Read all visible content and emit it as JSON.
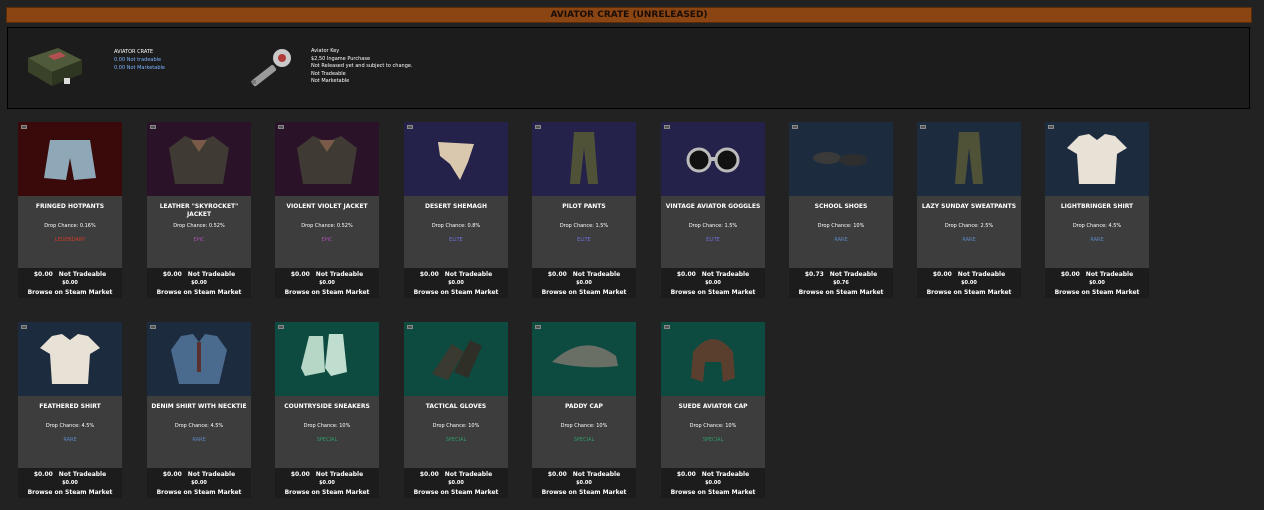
{
  "header": {
    "title": "AVIATOR CRATE (UNRELEASED)"
  },
  "crate": {
    "name": "AVIATOR CRATE",
    "tradeable": "0.00 Not tradeable",
    "marketable": "0.00 Not Marketable"
  },
  "key": {
    "name": "Aviator Key",
    "price": "$2,50 Ingame Purchase",
    "note": "Not Released yet and subject to change.",
    "tradeable": "Not Tradeable",
    "marketable": "Not Marketable"
  },
  "colors": {
    "title_bar": "#8b4513",
    "legendary": "#d03b2a",
    "epic": "#a64fb0",
    "elite": "#6f6fe0",
    "rare": "#5a86c0",
    "special": "#2f9a6a"
  },
  "items": [
    {
      "name": "FRINGED HOTPANTS",
      "chance": "Drop Chance: 0.16%",
      "rarity": "LEGENDARY",
      "price": "$0.00",
      "status": "Not Tradeable",
      "sub": "$0.00",
      "browse": "Browse on Steam Market",
      "bg": "#3a0a0a",
      "icon": "shorts-icon"
    },
    {
      "name": "LEATHER \"SKYROCKET\" JACKET",
      "chance": "Drop Chance: 0.52%",
      "rarity": "EPIC",
      "price": "$0.00",
      "status": "Not Tradeable",
      "sub": "$0.00",
      "browse": "Browse on Steam Market",
      "bg": "#2a1328",
      "icon": "jacket-icon"
    },
    {
      "name": "VIOLENT VIOLET JACKET",
      "chance": "Drop Chance: 0.52%",
      "rarity": "EPIC",
      "price": "$0.00",
      "status": "Not Tradeable",
      "sub": "$0.00",
      "browse": "Browse on Steam Market",
      "bg": "#2a1328",
      "icon": "jacket-icon"
    },
    {
      "name": "DESERT SHEMAGH",
      "chance": "Drop Chance: 0.8%",
      "rarity": "ELITE",
      "price": "$0.00",
      "status": "Not Tradeable",
      "sub": "$0.00",
      "browse": "Browse on Steam Market",
      "bg": "#24214a",
      "icon": "scarf-icon"
    },
    {
      "name": "PILOT PANTS",
      "chance": "Drop Chance: 1.5%",
      "rarity": "ELITE",
      "price": "$0.00",
      "status": "Not Tradeable",
      "sub": "$0.00",
      "browse": "Browse on Steam Market",
      "bg": "#24214a",
      "icon": "pants-icon"
    },
    {
      "name": "VINTAGE AVIATOR GOGGLES",
      "chance": "Drop Chance: 1.5%",
      "rarity": "ELITE",
      "price": "$0.00",
      "status": "Not Tradeable",
      "sub": "$0.00",
      "browse": "Browse on Steam Market",
      "bg": "#24214a",
      "icon": "goggles-icon"
    },
    {
      "name": "SCHOOL SHOES",
      "chance": "Drop Chance: 10%",
      "rarity": "RARE",
      "price": "$0.73",
      "status": "Not Tradeable",
      "sub": "$0.76",
      "browse": "Browse on Steam Market",
      "bg": "#1d2b3e",
      "icon": "shoes-icon"
    },
    {
      "name": "LAZY SUNDAY SWEATPANTS",
      "chance": "Drop Chance: 2.5%",
      "rarity": "RARE",
      "price": "$0.00",
      "status": "Not Tradeable",
      "sub": "$0.00",
      "browse": "Browse on Steam Market",
      "bg": "#1d2b3e",
      "icon": "pants-icon"
    },
    {
      "name": "LIGHTBRINGER SHIRT",
      "chance": "Drop Chance: 4.5%",
      "rarity": "RARE",
      "price": "$0.00",
      "status": "Not Tradeable",
      "sub": "$0.00",
      "browse": "Browse on Steam Market",
      "bg": "#1d2b3e",
      "icon": "tshirt-icon"
    },
    {
      "name": "FEATHERED SHIRT",
      "chance": "Drop Chance: 4.5%",
      "rarity": "RARE",
      "price": "$0.00",
      "status": "Not Tradeable",
      "sub": "$0.00",
      "browse": "Browse on Steam Market",
      "bg": "#1d2b3e",
      "icon": "tshirt-icon"
    },
    {
      "name": "DENIM SHIRT WITH NECKTIE",
      "chance": "Drop Chance: 4.5%",
      "rarity": "RARE",
      "price": "$0.00",
      "status": "Not Tradeable",
      "sub": "$0.00",
      "browse": "Browse on Steam Market",
      "bg": "#1d2b3e",
      "icon": "shirt-icon"
    },
    {
      "name": "COUNTRYSIDE SNEAKERS",
      "chance": "Drop Chance: 10%",
      "rarity": "SPECIAL",
      "price": "$0.00",
      "status": "Not Tradeable",
      "sub": "$0.00",
      "browse": "Browse on Steam Market",
      "bg": "#0d4a40",
      "icon": "sneakers-icon"
    },
    {
      "name": "TACTICAL GLOVES",
      "chance": "Drop Chance: 10%",
      "rarity": "SPECIAL",
      "price": "$0.00",
      "status": "Not Tradeable",
      "sub": "$0.00",
      "browse": "Browse on Steam Market",
      "bg": "#0d4a40",
      "icon": "gloves-icon"
    },
    {
      "name": "PADDY CAP",
      "chance": "Drop Chance: 10%",
      "rarity": "SPECIAL",
      "price": "$0.00",
      "status": "Not Tradeable",
      "sub": "$0.00",
      "browse": "Browse on Steam Market",
      "bg": "#0d4a40",
      "icon": "cap-icon"
    },
    {
      "name": "SUEDE AVIATOR CAP",
      "chance": "Drop Chance: 10%",
      "rarity": "SPECIAL",
      "price": "$0.00",
      "status": "Not Tradeable",
      "sub": "$0.00",
      "browse": "Browse on Steam Market",
      "bg": "#0d4a40",
      "icon": "aviator-cap-icon"
    }
  ]
}
